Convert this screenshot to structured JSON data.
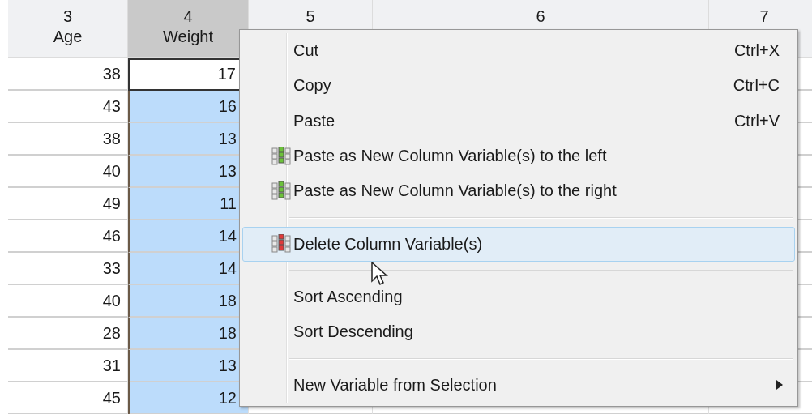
{
  "table": {
    "columns": [
      {
        "number": "3",
        "name": "Age",
        "selected": false
      },
      {
        "number": "4",
        "name": "Weight",
        "selected": true
      },
      {
        "number": "5",
        "selected": false
      },
      {
        "number": "6",
        "selected": false
      },
      {
        "number": "7",
        "selected": false
      }
    ],
    "rows": [
      {
        "cells": [
          "38",
          "17"
        ],
        "active": true
      },
      {
        "cells": [
          "43",
          "16"
        ],
        "active": false
      },
      {
        "cells": [
          "38",
          "13"
        ],
        "active": false
      },
      {
        "cells": [
          "40",
          "13"
        ],
        "active": false
      },
      {
        "cells": [
          "49",
          "11"
        ],
        "active": false
      },
      {
        "cells": [
          "46",
          "14"
        ],
        "active": false
      },
      {
        "cells": [
          "33",
          "14"
        ],
        "active": false
      },
      {
        "cells": [
          "40",
          "18"
        ],
        "active": false
      },
      {
        "cells": [
          "28",
          "18"
        ],
        "active": false
      },
      {
        "cells": [
          "31",
          "13"
        ],
        "active": false
      },
      {
        "cells": [
          "45",
          "12"
        ],
        "active": false
      }
    ]
  },
  "context_menu": {
    "items": [
      {
        "kind": "command",
        "label": "Cut",
        "shortcut": "Ctrl+X",
        "selected": false
      },
      {
        "kind": "command",
        "label": "Copy",
        "shortcut": "Ctrl+C",
        "selected": false
      },
      {
        "kind": "command",
        "label": "Paste",
        "shortcut": "Ctrl+V",
        "selected": false
      },
      {
        "kind": "paste-column",
        "label": "Paste as New Column Variable(s) to the left",
        "selected": false
      },
      {
        "kind": "paste-column",
        "label": "Paste as New Column Variable(s) to the right",
        "selected": false
      },
      {
        "kind": "separator"
      },
      {
        "kind": "delete-column",
        "label": "Delete Column Variable(s)",
        "selected": true
      },
      {
        "kind": "separator"
      },
      {
        "kind": "command",
        "label": "Sort Ascending",
        "selected": false
      },
      {
        "kind": "command",
        "label": "Sort Descending",
        "selected": false
      },
      {
        "kind": "separator"
      },
      {
        "kind": "submenu",
        "label": "New Variable from Selection",
        "selected": false
      }
    ]
  }
}
